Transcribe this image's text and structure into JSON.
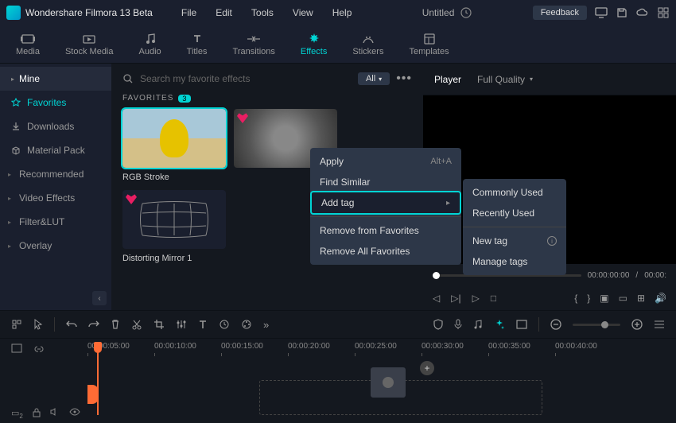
{
  "app": {
    "name": "Wondershare Filmora 13 Beta",
    "doc_title": "Untitled"
  },
  "menu": {
    "file": "File",
    "edit": "Edit",
    "tools": "Tools",
    "view": "View",
    "help": "Help"
  },
  "header": {
    "feedback": "Feedback"
  },
  "tabs": {
    "media": "Media",
    "stock": "Stock Media",
    "audio": "Audio",
    "titles": "Titles",
    "transitions": "Transitions",
    "effects": "Effects",
    "stickers": "Stickers",
    "templates": "Templates"
  },
  "sidebar": {
    "mine": "Mine",
    "items": [
      {
        "label": "Favorites"
      },
      {
        "label": "Downloads"
      },
      {
        "label": "Material Pack"
      },
      {
        "label": "Recommended"
      },
      {
        "label": "Video Effects"
      },
      {
        "label": "Filter&LUT"
      },
      {
        "label": "Overlay"
      }
    ]
  },
  "content": {
    "search_placeholder": "Search my favorite effects",
    "filter_all": "All",
    "section_label": "FAVORITES",
    "fav_count": "3",
    "thumbs": [
      {
        "label": "RGB Stroke"
      },
      {
        "label": "Distorting Mirror 1"
      }
    ]
  },
  "ctx": {
    "apply": "Apply",
    "apply_shortcut": "Alt+A",
    "find_similar": "Find Similar",
    "add_tag": "Add tag",
    "remove_fav": "Remove from Favorites",
    "remove_all": "Remove All Favorites"
  },
  "submenu": {
    "commonly": "Commonly Used",
    "recently": "Recently Used",
    "new_tag": "New tag",
    "manage": "Manage tags"
  },
  "player": {
    "label": "Player",
    "quality": "Full Quality",
    "time_current": "00:00:00:00",
    "time_total": "00:00:"
  },
  "timeline": {
    "marks": [
      "00:00:05:00",
      "00:00:10:00",
      "00:00:15:00",
      "00:00:20:00",
      "00:00:25:00",
      "00:00:30:00",
      "00:00:35:00",
      "00:00:40:00"
    ]
  }
}
